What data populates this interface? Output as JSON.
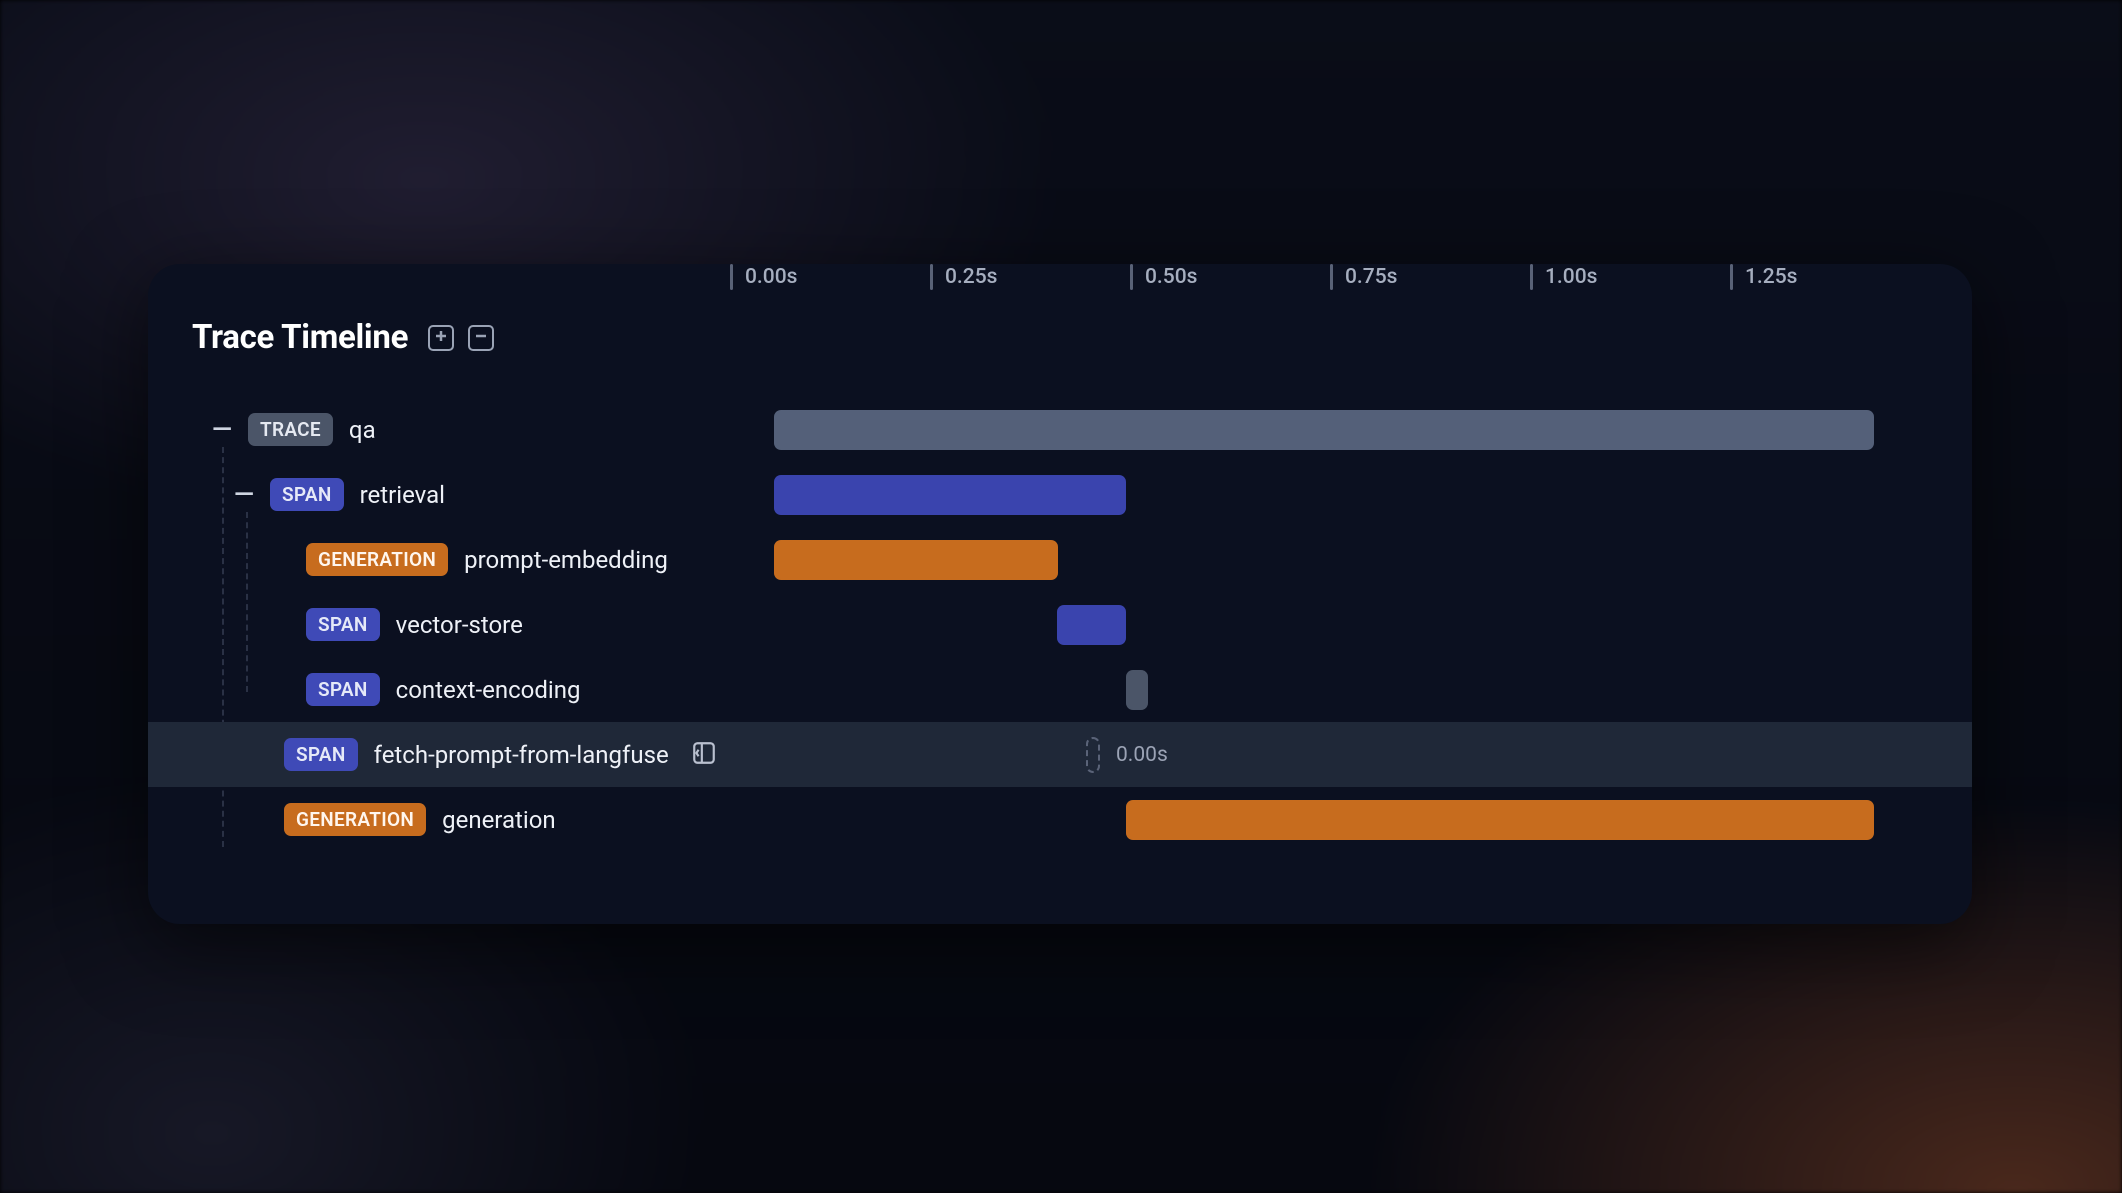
{
  "title": "Trace Timeline",
  "axis_ticks": [
    "0.00s",
    "0.25s",
    "0.50s",
    "0.75s",
    "1.00s",
    "1.25s"
  ],
  "chart_data": {
    "type": "gantt",
    "xlabel": "seconds",
    "xlim": [
      0,
      1.375
    ],
    "series": [
      {
        "id": "qa",
        "kind": "TRACE",
        "name": "qa",
        "depth": 0,
        "collapsible": true,
        "start_s": 0.0,
        "end_s": 1.375,
        "selected": false
      },
      {
        "id": "retrieval",
        "kind": "SPAN",
        "name": "retrieval",
        "depth": 1,
        "collapsible": true,
        "start_s": 0.0,
        "end_s": 0.44,
        "selected": false
      },
      {
        "id": "prompt-embedding",
        "kind": "GENERATION",
        "name": "prompt-embedding",
        "depth": 2,
        "collapsible": false,
        "start_s": 0.0,
        "end_s": 0.355,
        "selected": false
      },
      {
        "id": "vector-store",
        "kind": "SPAN",
        "name": "vector-store",
        "depth": 2,
        "collapsible": false,
        "start_s": 0.355,
        "end_s": 0.44,
        "selected": false
      },
      {
        "id": "context-encoding",
        "kind": "SPAN",
        "name": "context-encoding",
        "depth": 2,
        "collapsible": false,
        "start_s": 0.44,
        "end_s": 0.465,
        "selected": false
      },
      {
        "id": "fetch-prompt-from-langfuse",
        "kind": "SPAN",
        "name": "fetch-prompt-from-langfuse",
        "depth": 1,
        "collapsible": false,
        "start_s": 0.44,
        "end_s": 0.44,
        "selected": true,
        "duration_label": "0.00s"
      },
      {
        "id": "generation",
        "kind": "GENERATION",
        "name": "generation",
        "depth": 1,
        "collapsible": false,
        "start_s": 0.44,
        "end_s": 1.375,
        "selected": false
      }
    ]
  },
  "colors": {
    "panel_bg": "#0b1020",
    "trace": "#546079",
    "span": "#3a44ae",
    "generation": "#c76c1e"
  }
}
